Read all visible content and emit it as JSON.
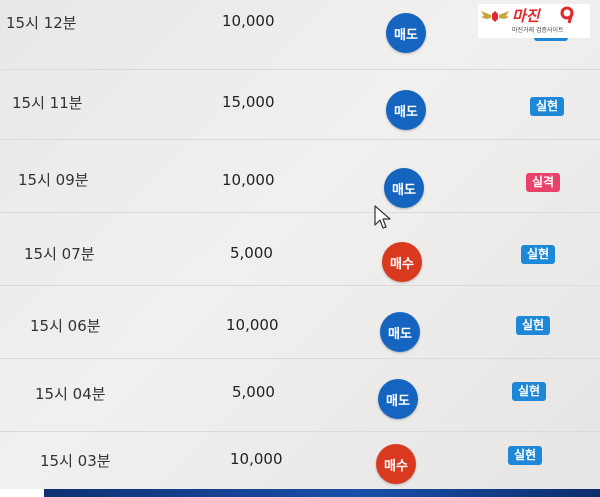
{
  "logo": {
    "title": "마진",
    "sub": "마진거래 검증사이트"
  },
  "trades": [
    {
      "time": "15시 12분",
      "amount": "10,000",
      "side": "매도",
      "side_type": "sell",
      "result": "실현",
      "result_type": "ok"
    },
    {
      "time": "15시 11분",
      "amount": "15,000",
      "side": "매도",
      "side_type": "sell",
      "result": "실현",
      "result_type": "ok"
    },
    {
      "time": "15시 09분",
      "amount": "10,000",
      "side": "매도",
      "side_type": "sell",
      "result": "실격",
      "result_type": "fail"
    },
    {
      "time": "15시 07분",
      "amount": "5,000",
      "side": "매수",
      "side_type": "buy",
      "result": "실현",
      "result_type": "ok"
    },
    {
      "time": "15시 06분",
      "amount": "10,000",
      "side": "매도",
      "side_type": "sell",
      "result": "실현",
      "result_type": "ok"
    },
    {
      "time": "15시 04분",
      "amount": "5,000",
      "side": "매도",
      "side_type": "sell",
      "result": "실현",
      "result_type": "ok"
    },
    {
      "time": "15시 03분",
      "amount": "10,000",
      "side": "매수",
      "side_type": "buy",
      "result": "실현",
      "result_type": "ok"
    }
  ],
  "colors": {
    "sell": "#1565c0",
    "buy": "#d93a1f",
    "result_ok": "#1e88d8",
    "result_fail": "#e8416a"
  }
}
